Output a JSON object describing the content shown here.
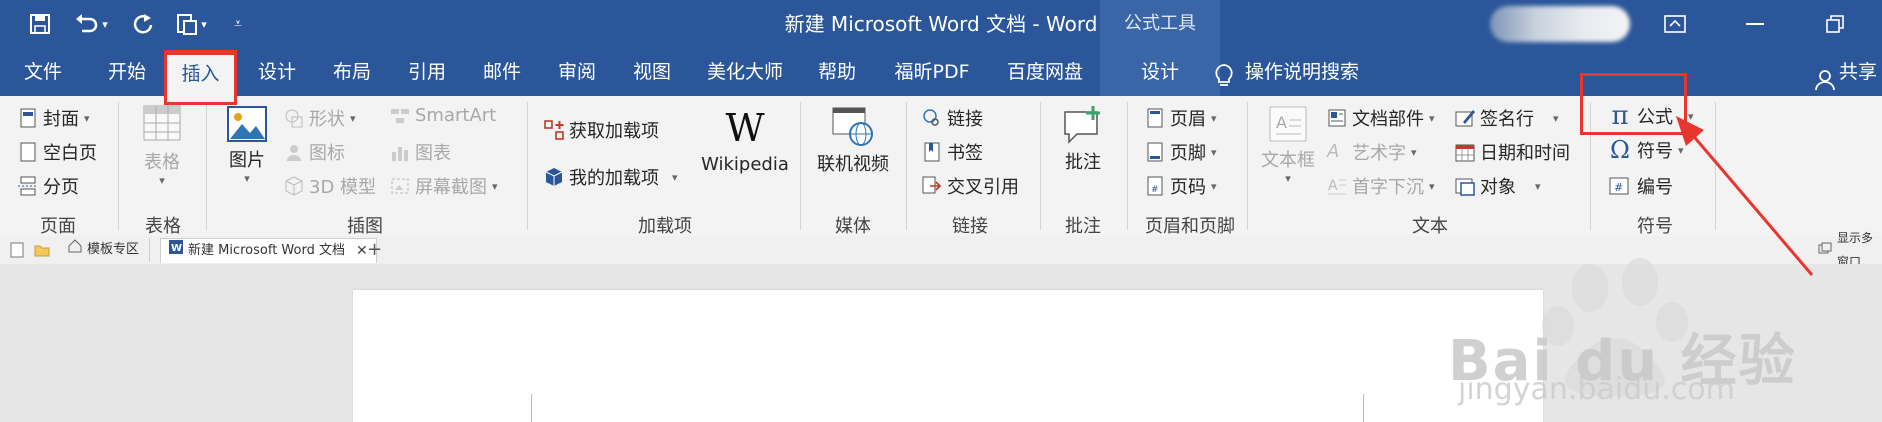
{
  "window": {
    "title": "新建 Microsoft Word 文档  -  Word",
    "context_tool": "公式工具"
  },
  "tabs": [
    {
      "label": "文件"
    },
    {
      "label": "开始"
    },
    {
      "label": "插入"
    },
    {
      "label": "设计"
    },
    {
      "label": "布局"
    },
    {
      "label": "引用"
    },
    {
      "label": "邮件"
    },
    {
      "label": "审阅"
    },
    {
      "label": "视图"
    },
    {
      "label": "美化大师"
    },
    {
      "label": "帮助"
    },
    {
      "label": "福昕PDF"
    },
    {
      "label": "百度网盘"
    },
    {
      "label": "设计"
    }
  ],
  "tell_me": "操作说明搜索",
  "share": "共享",
  "ribbon": {
    "page": {
      "cover": "封面",
      "blank": "空白页",
      "break": "分页",
      "group": "页面"
    },
    "table": {
      "table": "表格",
      "group": "表格"
    },
    "illustrations": {
      "picture": "图片",
      "shapes": "形状",
      "icons": "图标",
      "model3d": "3D 模型",
      "smartart": "SmartArt",
      "chart": "图表",
      "screenshot": "屏幕截图",
      "group": "插图"
    },
    "addins": {
      "get": "获取加载项",
      "my": "我的加载项",
      "wikipedia": "Wikipedia",
      "group": "加载项"
    },
    "media": {
      "online_video": "联机视频",
      "group": "媒体"
    },
    "links": {
      "link": "链接",
      "bookmark": "书签",
      "crossref": "交叉引用",
      "group": "链接"
    },
    "comments": {
      "comment": "批注",
      "group": "批注"
    },
    "headerfooter": {
      "header": "页眉",
      "footer": "页脚",
      "pagenum": "页码",
      "group": "页眉和页脚"
    },
    "text": {
      "textbox": "文本框",
      "quickparts": "文档部件",
      "wordart": "艺术字",
      "dropcap": "首字下沉",
      "signature": "签名行",
      "datetime": "日期和时间",
      "object": "对象",
      "group": "文本"
    },
    "symbols": {
      "equation": "公式",
      "symbol": "符号",
      "numbering": "编号",
      "group": "符号"
    }
  },
  "doc_tabs": {
    "template": "模板专区",
    "document": "新建 Microsoft Word 文档",
    "show_multi": "显示多窗口"
  },
  "watermark": {
    "brand": "Bai du 经验",
    "url": "jingyan.baidu.com"
  },
  "colors": {
    "title_bar": "#2b579a",
    "highlight": "#e8352d",
    "ribbon_bg": "#f3f3f3"
  }
}
